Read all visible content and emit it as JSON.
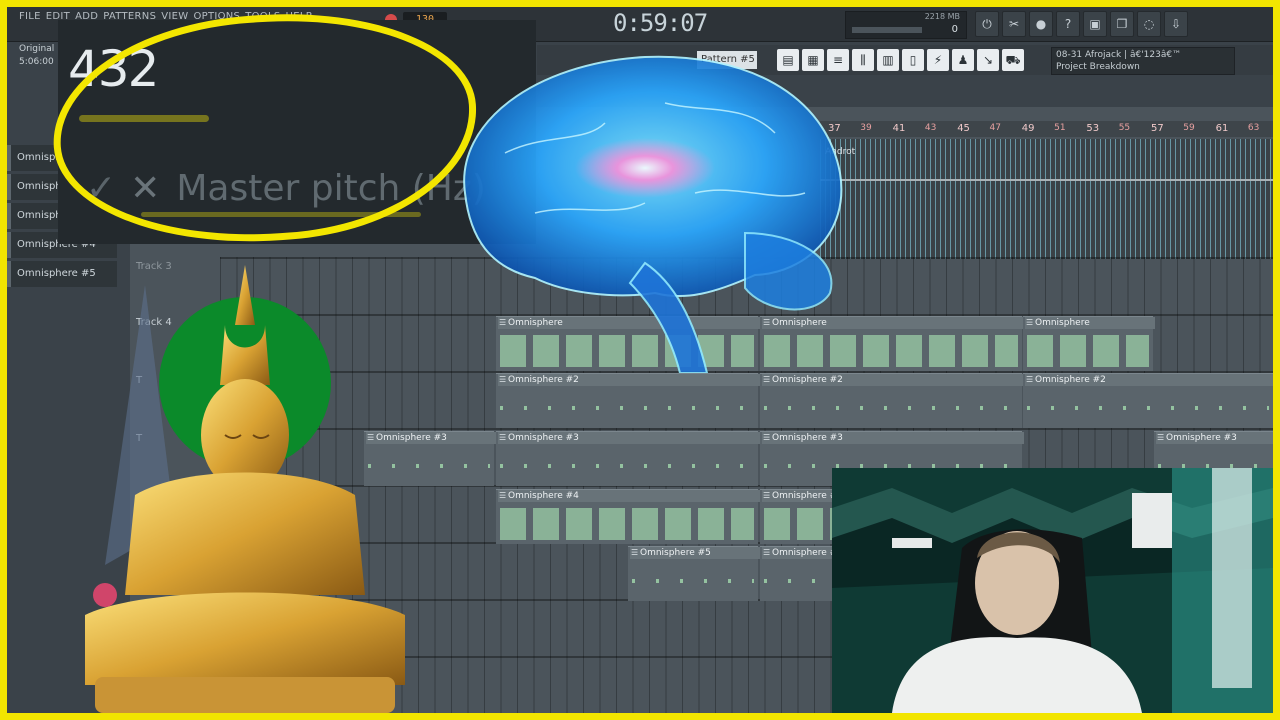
{
  "menu": [
    "FILE",
    "EDIT",
    "ADD",
    "PATTERNS",
    "VIEW",
    "OPTIONS",
    "TOOLS",
    "HELP"
  ],
  "transport": {
    "tempo": "130",
    "time": "0:59:07",
    "pattern": "Pattern #5"
  },
  "cpu": {
    "memory": "2218 MB",
    "value": "0",
    "value_top": "12"
  },
  "hint": {
    "line1": "08-31  Afrojack | â€'123â€™",
    "line2": "Project Breakdown"
  },
  "info": {
    "label": "Original M",
    "time": "5:06:00"
  },
  "channels": [
    "Omnisphere",
    "Omnisphere",
    "Omnisphere",
    "Omnisphere #4",
    "Omnisphere #5"
  ],
  "pitch": {
    "value": "432",
    "label": "Master pitch (Hz)"
  },
  "ruler": [
    "37",
    "39",
    "41",
    "43",
    "45",
    "47",
    "49",
    "51",
    "53",
    "55",
    "57",
    "59",
    "61",
    "63"
  ],
  "audio_clip_label": "Androt",
  "tracks": [
    "Track 3",
    "Track 4",
    "T",
    "T"
  ],
  "clips": {
    "omni1": "Omnisphere",
    "omni2": "Omnisphere #2",
    "omni3": "Omnisphere #3",
    "omni4": "Omnisphere #4",
    "omni5": "Omnisphere #5"
  },
  "colors": {
    "frame": "#f2e500",
    "accent_time": "#c7d3d9",
    "brain": "#2aa8ff"
  },
  "icons": [
    "power-icon",
    "scissors-icon",
    "microphone-icon",
    "question-icon",
    "save-icon",
    "copy-icon",
    "chat-icon",
    "download-icon"
  ]
}
